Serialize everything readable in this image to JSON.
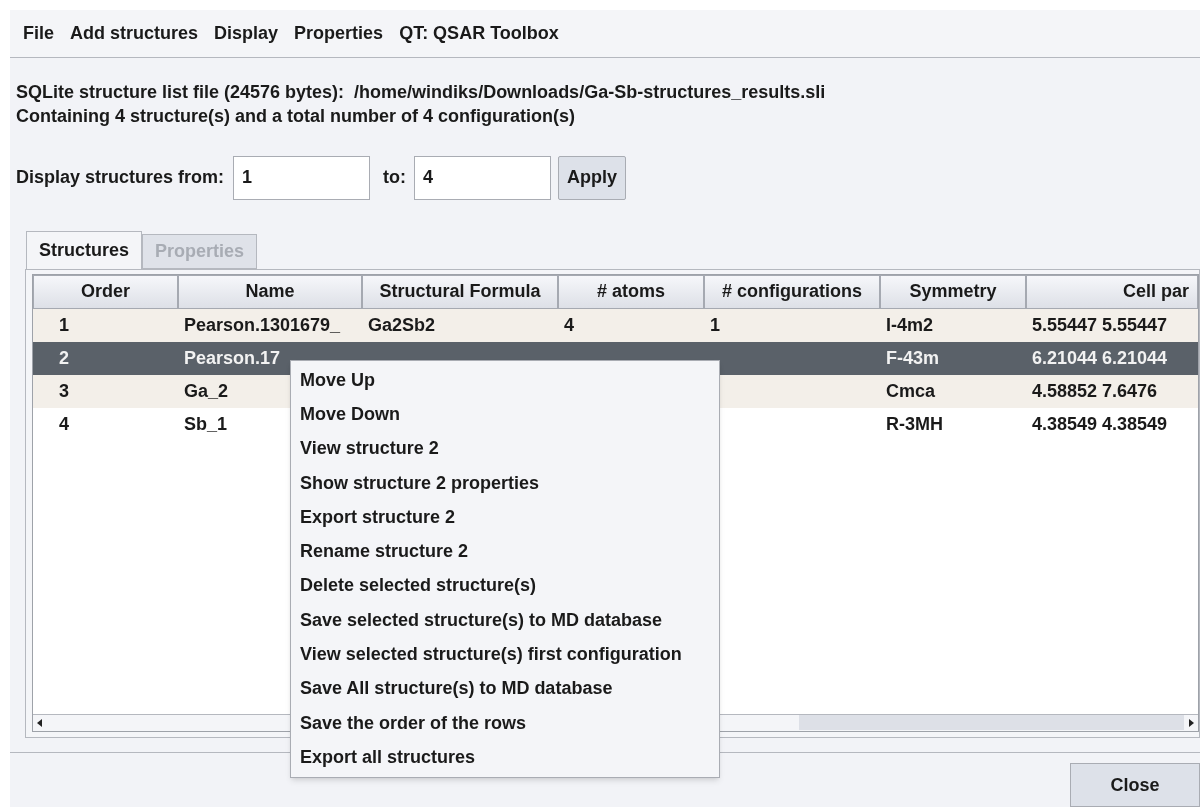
{
  "menu_bar": [
    "File",
    "Add structures",
    "Display",
    "Properties",
    "QT: QSAR Toolbox"
  ],
  "info_lines": [
    "SQLite structure list file (24576 bytes):  /home/windiks/Downloads/Ga-Sb-structures_results.sli",
    "Containing 4 structure(s) and a total number of 4 configuration(s)"
  ],
  "range": {
    "from_label": "Display structures from:",
    "from_value": "1",
    "to_label": "to:",
    "to_value": "4",
    "apply_button": "Apply"
  },
  "tabs": [
    {
      "label": "Structures",
      "selected": true,
      "disabled": false
    },
    {
      "label": "Properties",
      "selected": false,
      "disabled": true
    }
  ],
  "table": {
    "columns": [
      "Order",
      "Name",
      "Structural Formula",
      "# atoms",
      "# configurations",
      "Symmetry",
      "Cell par"
    ],
    "rows": [
      {
        "selected": false,
        "cells": [
          "1",
          "Pearson.1301679_",
          "Ga2Sb2",
          "4",
          "1",
          "I-4m2",
          "5.55447 5.55447"
        ]
      },
      {
        "selected": true,
        "cells": [
          "2",
          "Pearson.17",
          "",
          "",
          "",
          "F-43m",
          "6.21044 6.21044"
        ]
      },
      {
        "selected": false,
        "cells": [
          "3",
          "Ga_2",
          "",
          "",
          "",
          "Cmca",
          "4.58852 7.6476"
        ]
      },
      {
        "selected": false,
        "cells": [
          "4",
          "Sb_1",
          "",
          "",
          "",
          "R-3MH",
          "4.38549 4.38549"
        ]
      }
    ]
  },
  "context_menu": [
    "Move Up",
    "Move Down",
    "View structure 2",
    "Show structure 2 properties",
    "Export structure 2",
    "Rename structure 2",
    "Delete selected structure(s)",
    "Save selected structure(s) to MD database",
    "View selected structure(s) first configuration",
    "Save All structure(s) to MD database",
    "Save the order of the rows",
    "Export all structures"
  ],
  "close_button": "Close"
}
